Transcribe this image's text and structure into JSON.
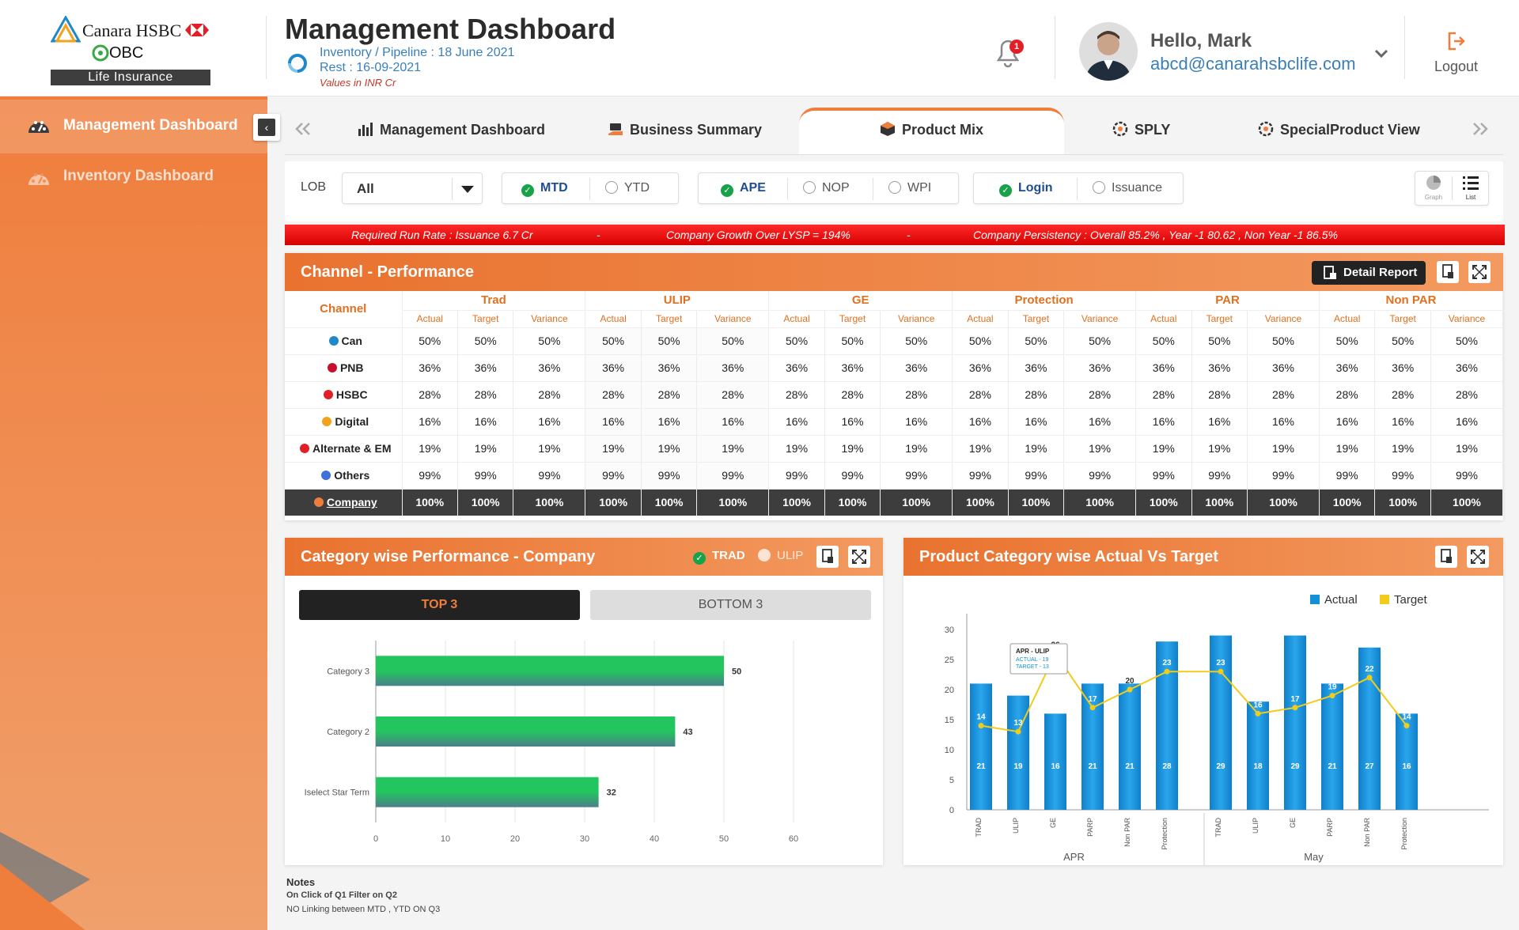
{
  "brand": {
    "line1": "Canara HSBC",
    "line2": "OBC",
    "line3": "Life Insurance"
  },
  "header": {
    "title": "Management Dashboard",
    "sub1": "Inventory / Pipeline : 18 June 2021",
    "sub2": "Rest : 16-09-2021",
    "sub3": "Values in INR Cr",
    "notification_count": "1",
    "greeting": "Hello, Mark",
    "email": "abcd@canarahsbclife.com",
    "logout": "Logout"
  },
  "sidebar": {
    "items": [
      {
        "label": "Management Dashboard"
      },
      {
        "label": "Inventory Dashboard"
      }
    ]
  },
  "tabs": [
    {
      "label": "Management Dashboard"
    },
    {
      "label": "Business Summary"
    },
    {
      "label": "Product Mix"
    },
    {
      "label": "SPLY"
    },
    {
      "label": "SpecialProduct View"
    }
  ],
  "filters": {
    "lob_label": "LOB",
    "lob_value": "All",
    "period": [
      "MTD",
      "YTD"
    ],
    "metric": [
      "APE",
      "NOP",
      "WPI"
    ],
    "stage": [
      "Login",
      "Issuance"
    ],
    "view": [
      "Graph",
      "List"
    ]
  },
  "ticker": {
    "item1": "Required Run Rate : Issuance 6.7 Cr",
    "item2": "Company Growth Over LYSP = 194%",
    "item3": "Company Persistency : Overall 85.2% , Year -1 80.62 , Non Year -1 86.5%",
    "dash": "-"
  },
  "channel_perf": {
    "title": "Channel - Performance",
    "detail_btn": "Detail Report",
    "channel_header": "Channel",
    "groups": [
      "Trad",
      "ULIP",
      "GE",
      "Protection",
      "PAR",
      "Non PAR"
    ],
    "sub": [
      "Actual",
      "Target",
      "Variance"
    ],
    "rows": [
      {
        "name": "Can",
        "v": "50%"
      },
      {
        "name": "PNB",
        "v": "36%"
      },
      {
        "name": "HSBC",
        "v": "28%"
      },
      {
        "name": "Digital",
        "v": "16%"
      },
      {
        "name": "Alternate & EM",
        "v": "19%"
      },
      {
        "name": "Others",
        "v": "99%"
      },
      {
        "name": "Company",
        "v": "100%"
      }
    ]
  },
  "category_perf": {
    "title": "Category wise Performance - Company",
    "toggle": [
      "TRAD",
      "ULIP"
    ],
    "btn_top": "TOP 3",
    "btn_bottom": "BOTTOM 3"
  },
  "product_cat": {
    "title": "Product Category wise Actual Vs Target",
    "legend": [
      "Actual",
      "Target"
    ],
    "tooltip": {
      "title": "APR - ULIP",
      "actual": "ACTUAL - 19",
      "target": "TARGET - 13"
    }
  },
  "notes": {
    "title": "Notes",
    "line1": "On Click of Q1 Filter on Q2",
    "line2": "NO Linking between MTD , YTD ON Q3"
  },
  "colors": {
    "accent": "#ef7d3c",
    "actual": "#1490d6",
    "target": "#f1cc1a",
    "bar": "#22c55e"
  },
  "chart_data": [
    {
      "type": "bar",
      "orientation": "horizontal",
      "categories": [
        "Category 3",
        "Category 2",
        "Iselect Star Term"
      ],
      "values": [
        50,
        43,
        32
      ],
      "xlim": [
        0,
        60
      ],
      "xticks": [
        0,
        10,
        20,
        30,
        40,
        50,
        60
      ],
      "grid": true
    },
    {
      "type": "bar+line",
      "groups": [
        {
          "name": "APR",
          "categories": [
            "TRAD",
            "ULIP",
            "GE",
            "PARP",
            "Non PAR",
            "Protection"
          ],
          "actual": [
            21,
            19,
            16,
            21,
            21,
            28
          ],
          "target": [
            14,
            13,
            26,
            17,
            20,
            23
          ]
        },
        {
          "name": "May",
          "categories": [
            "TRAD",
            "ULIP",
            "GE",
            "PARP",
            "Non PAR",
            "Protection"
          ],
          "actual": [
            29,
            18,
            29,
            21,
            27,
            16
          ],
          "target": [
            23,
            16,
            17,
            19,
            22,
            14
          ]
        }
      ],
      "ylim": [
        0,
        30
      ],
      "yticks": [
        0,
        5,
        10,
        15,
        20,
        25,
        30
      ],
      "series": [
        {
          "name": "Actual"
        },
        {
          "name": "Target"
        }
      ],
      "legend": "top-right"
    }
  ]
}
